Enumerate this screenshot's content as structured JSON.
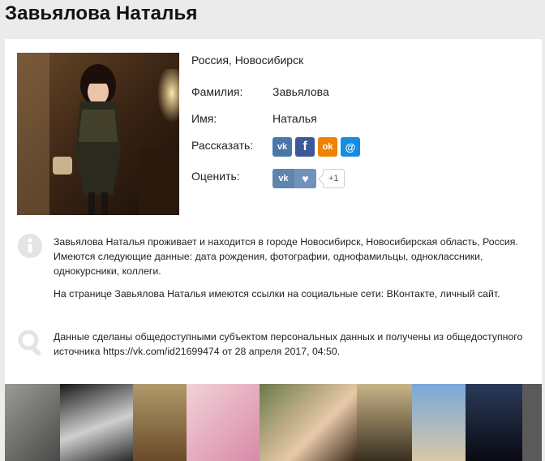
{
  "title": "Завьялова Наталья",
  "location": "Россия, Новосибирск",
  "fields": [
    {
      "label": "Фамилия:",
      "value": "Завьялова"
    },
    {
      "label": "Имя:",
      "value": "Наталья"
    }
  ],
  "share": {
    "label": "Рассказать:",
    "buttons": [
      {
        "name": "vk-share",
        "icon": "vk-icon",
        "color": "#4a76a8",
        "glyph": "vk"
      },
      {
        "name": "facebook-share",
        "icon": "facebook-icon",
        "color": "#3b5998",
        "glyph": "f"
      },
      {
        "name": "odnoklassniki-share",
        "icon": "odnoklassniki-icon",
        "color": "#ee8208",
        "glyph": "ok"
      },
      {
        "name": "moimir-share",
        "icon": "moimir-icon",
        "color": "#168de2",
        "glyph": "@"
      }
    ]
  },
  "rate": {
    "label": "Оценить:",
    "vk_glyph": "vk",
    "heart_glyph": "♥",
    "count": "+1"
  },
  "about": {
    "p1": "Завьялова Наталья проживает и находится в городе Новосибирск, Новосибирская область, Россия. Имеются следующие данные: дата рождения, фотографии, однофамильцы, одноклассники, однокурсники, коллеги.",
    "p2": "На странице Завьялова Наталья имеются ссылки на социальные сети: ВКонтакте, личный сайт."
  },
  "source": {
    "text": "Данные сделаны общедоступными субъектом персональных данных и получены из общедоступного источника https://vk.com/id21699474 от 28 апреля 2017, 04:50."
  },
  "colors": {
    "background": "#ebebeb",
    "card": "#ffffff",
    "icon_gray": "#e4e4e4"
  }
}
